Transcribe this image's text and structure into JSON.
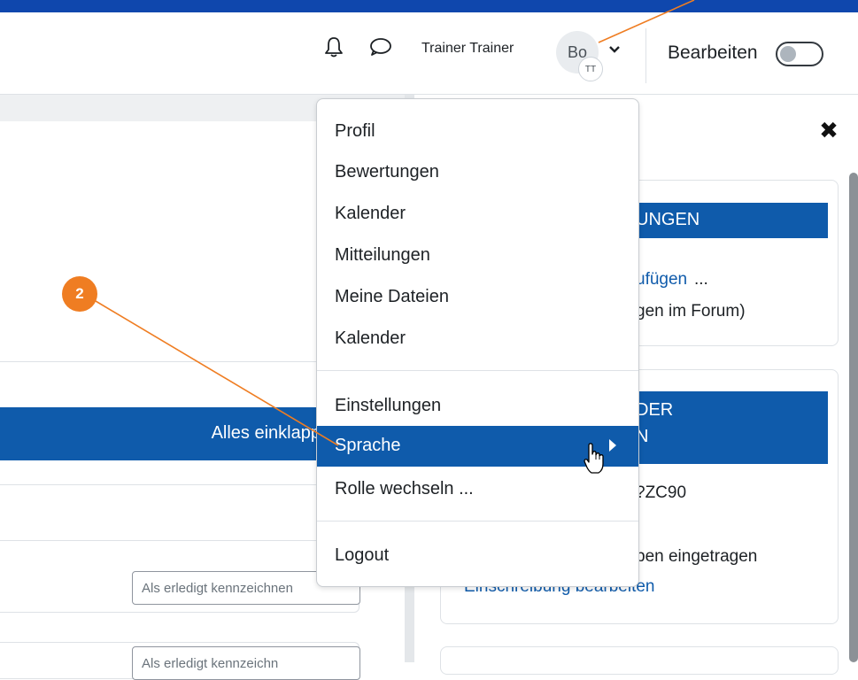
{
  "header": {
    "user_name": "Trainer Trainer",
    "avatar_initials": "Bo",
    "avatar_badge": "TT",
    "edit_mode_label": "Bearbeiten",
    "edit_mode_on": false
  },
  "user_menu": {
    "group1": [
      "Profil",
      "Bewertungen",
      "Kalender",
      "Mitteilungen",
      "Meine Dateien",
      "Kalender"
    ],
    "group2": [
      "Einstellungen",
      "Sprache",
      "Rolle wechseln ..."
    ],
    "group3": [
      "Logout"
    ],
    "active_item": "Sprache"
  },
  "main": {
    "collapse_all_label": "Alles einklapp",
    "mark_done_label": "Als erledigt kennzeichnen",
    "mark_done_label_2": "Als erledigt kennzeichn"
  },
  "drawer": {
    "card1": {
      "heading": "UNGEN",
      "link_text": "ufügen",
      "ellipsis": "...",
      "text": "gen im Forum)"
    },
    "card2": {
      "heading_line1": "DER",
      "heading_line2": "N",
      "code": "?ZC90",
      "text": "pen eingetragen",
      "link_text": "Einschreibung bearbeiten"
    }
  },
  "annotation": {
    "badge_number": "2",
    "color": "#ef7d22"
  },
  "colors": {
    "primary": "#0f5bab",
    "topbar": "#0f47ad"
  }
}
